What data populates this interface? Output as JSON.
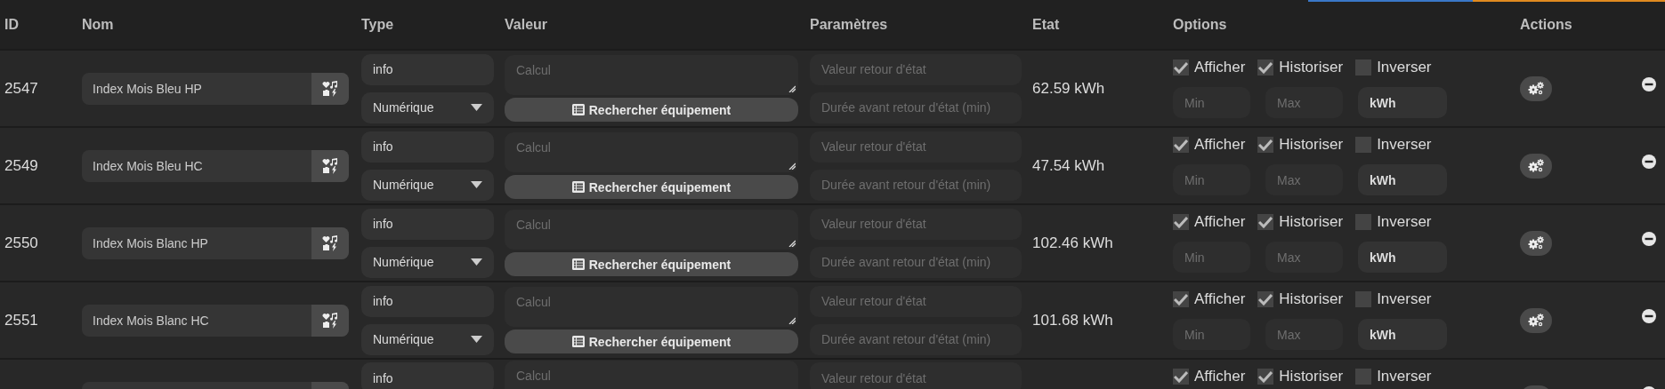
{
  "columns": [
    "ID",
    "Nom",
    "Type",
    "Valeur",
    "Paramètres",
    "Etat",
    "Options",
    "Actions"
  ],
  "rows": [
    {
      "id": "2547",
      "name": "Index Mois Bleu HP",
      "type": "info",
      "subtype": "Numérique",
      "value_placeholder": "Calcul",
      "search_button": "Rechercher équipement",
      "return_value_placeholder": "Valeur retour d'état",
      "return_delay_placeholder": "Durée avant retour d'état (min)",
      "state": "62.59 kWh",
      "options": [
        {
          "label": "Afficher",
          "checked": true
        },
        {
          "label": "Historiser",
          "checked": true
        },
        {
          "label": "Inverser",
          "checked": false
        }
      ],
      "min_placeholder": "Min",
      "max_placeholder": "Max",
      "unit": "kWh"
    },
    {
      "id": "2549",
      "name": "Index Mois Bleu HC",
      "type": "info",
      "subtype": "Numérique",
      "value_placeholder": "Calcul",
      "search_button": "Rechercher équipement",
      "return_value_placeholder": "Valeur retour d'état",
      "return_delay_placeholder": "Durée avant retour d'état (min)",
      "state": "47.54 kWh",
      "options": [
        {
          "label": "Afficher",
          "checked": true
        },
        {
          "label": "Historiser",
          "checked": true
        },
        {
          "label": "Inverser",
          "checked": false
        }
      ],
      "min_placeholder": "Min",
      "max_placeholder": "Max",
      "unit": "kWh"
    },
    {
      "id": "2550",
      "name": "Index Mois Blanc HP",
      "type": "info",
      "subtype": "Numérique",
      "value_placeholder": "Calcul",
      "search_button": "Rechercher équipement",
      "return_value_placeholder": "Valeur retour d'état",
      "return_delay_placeholder": "Durée avant retour d'état (min)",
      "state": "102.46 kWh",
      "options": [
        {
          "label": "Afficher",
          "checked": true
        },
        {
          "label": "Historiser",
          "checked": true
        },
        {
          "label": "Inverser",
          "checked": false
        }
      ],
      "min_placeholder": "Min",
      "max_placeholder": "Max",
      "unit": "kWh"
    },
    {
      "id": "2551",
      "name": "Index Mois Blanc HC",
      "type": "info",
      "subtype": "Numérique",
      "value_placeholder": "Calcul",
      "search_button": "Rechercher équipement",
      "return_value_placeholder": "Valeur retour d'état",
      "return_delay_placeholder": "Durée avant retour d'état (min)",
      "state": "101.68 kWh",
      "options": [
        {
          "label": "Afficher",
          "checked": true
        },
        {
          "label": "Historiser",
          "checked": true
        },
        {
          "label": "Inverser",
          "checked": false
        }
      ],
      "min_placeholder": "Min",
      "max_placeholder": "Max",
      "unit": "kWh"
    },
    {
      "type": "info",
      "value_placeholder": "Calcul",
      "return_value_placeholder": "Valeur retour d'état",
      "options": [
        {
          "label": "Afficher",
          "checked": true
        },
        {
          "label": "Historiser",
          "checked": true
        },
        {
          "label": "Inverser",
          "checked": false
        }
      ]
    }
  ]
}
